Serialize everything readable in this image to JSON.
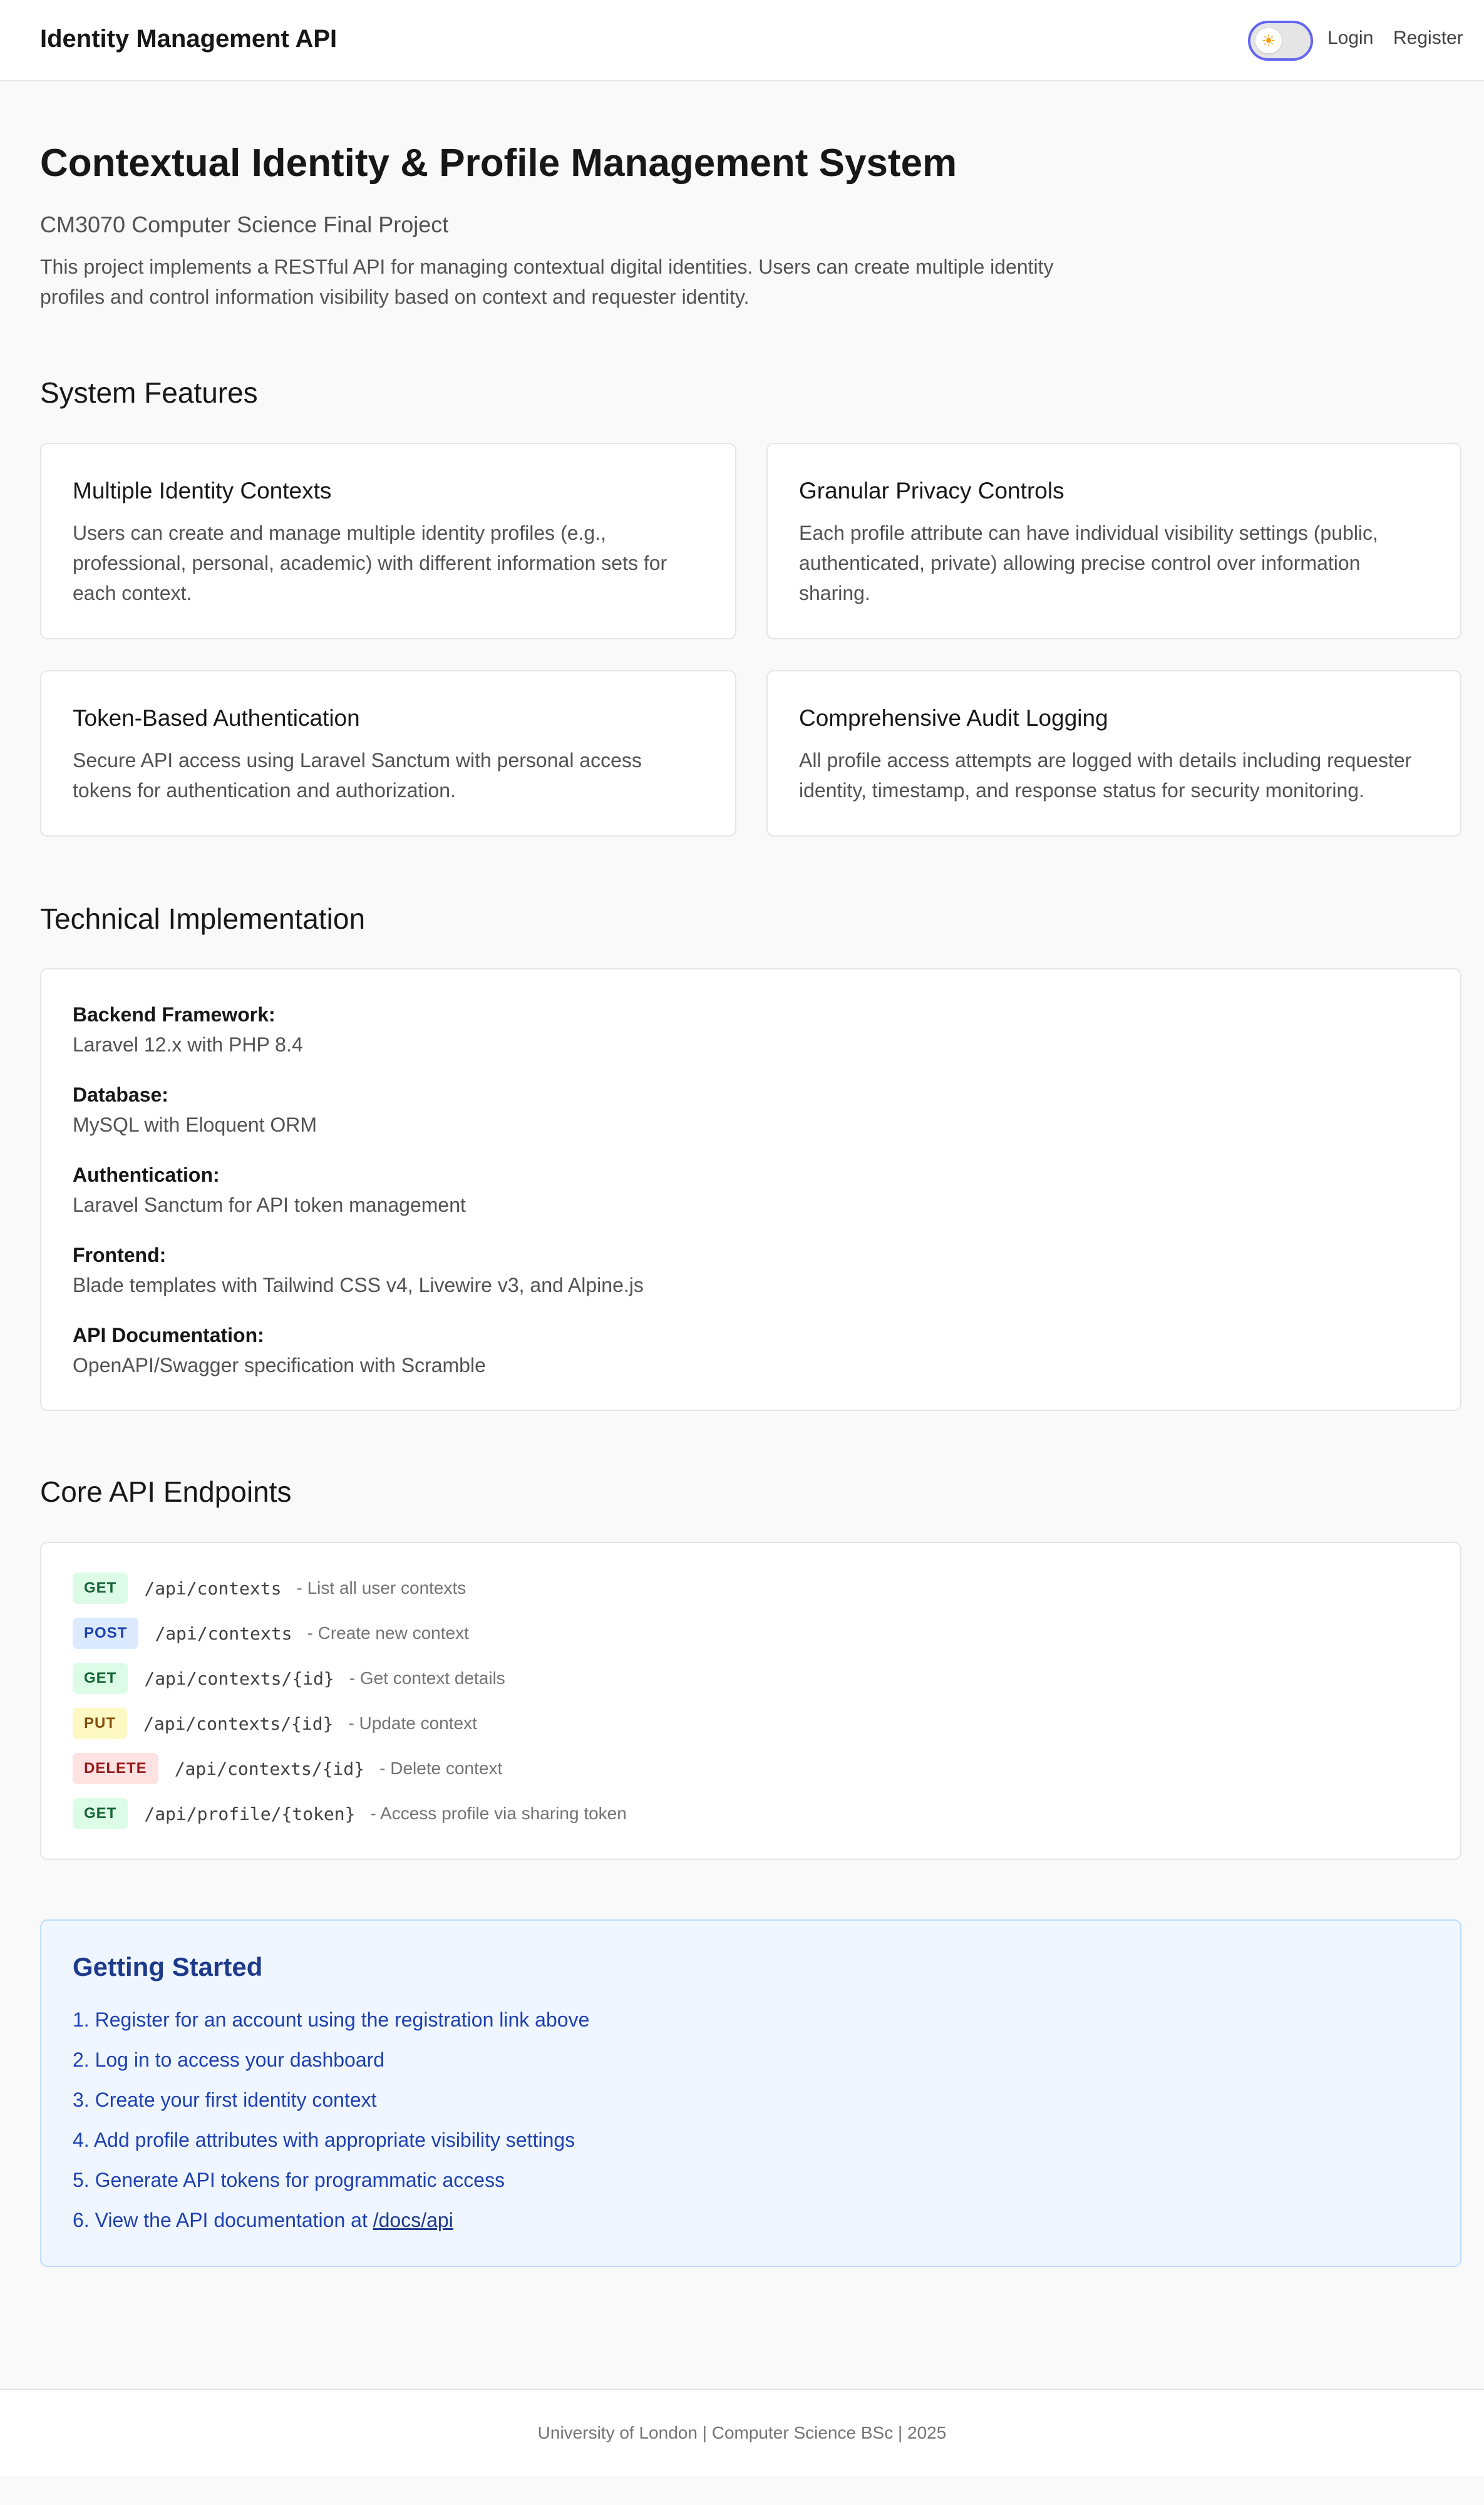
{
  "header": {
    "brand": "Identity Management API",
    "theme_icon": "sun-icon",
    "login_label": "Login",
    "register_label": "Register"
  },
  "hero": {
    "title": "Contextual Identity & Profile Management System",
    "subtitle": "CM3070 Computer Science Final Project",
    "description": "This project implements a RESTful API for managing contextual digital identities. Users can create multiple identity profiles and control information visibility based on context and requester identity."
  },
  "features": {
    "heading": "System Features",
    "items": [
      {
        "title": "Multiple Identity Contexts",
        "text": "Users can create and manage multiple identity profiles (e.g., professional, personal, academic) with different information sets for each context."
      },
      {
        "title": "Granular Privacy Controls",
        "text": "Each profile attribute can have individual visibility settings (public, authenticated, private) allowing precise control over information sharing."
      },
      {
        "title": "Token-Based Authentication",
        "text": "Secure API access using Laravel Sanctum with personal access tokens for authentication and authorization."
      },
      {
        "title": "Comprehensive Audit Logging",
        "text": "All profile access attempts are logged with details including requester identity, timestamp, and response status for security monitoring."
      }
    ]
  },
  "tech": {
    "heading": "Technical Implementation",
    "items": [
      {
        "label": "Backend Framework:",
        "value": "Laravel 12.x with PHP 8.4"
      },
      {
        "label": "Database:",
        "value": "MySQL with Eloquent ORM"
      },
      {
        "label": "Authentication:",
        "value": "Laravel Sanctum for API token management"
      },
      {
        "label": "Frontend:",
        "value": "Blade templates with Tailwind CSS v4, Livewire v3, and Alpine.js"
      },
      {
        "label": "API Documentation:",
        "value": "OpenAPI/Swagger specification with Scramble"
      }
    ]
  },
  "endpoints": {
    "heading": "Core API Endpoints",
    "items": [
      {
        "method": "GET",
        "path": "/api/contexts",
        "desc": "- List all user contexts"
      },
      {
        "method": "POST",
        "path": "/api/contexts",
        "desc": "- Create new context"
      },
      {
        "method": "GET",
        "path": "/api/contexts/{id}",
        "desc": "- Get context details"
      },
      {
        "method": "PUT",
        "path": "/api/contexts/{id}",
        "desc": "- Update context"
      },
      {
        "method": "DELETE",
        "path": "/api/contexts/{id}",
        "desc": "- Delete context"
      },
      {
        "method": "GET",
        "path": "/api/profile/{token}",
        "desc": "- Access profile via sharing token"
      }
    ]
  },
  "getting_started": {
    "title": "Getting Started",
    "steps": [
      "1. Register for an account using the registration link above",
      "2. Log in to access your dashboard",
      "3. Create your first identity context",
      "4. Add profile attributes with appropriate visibility settings",
      "5. Generate API tokens for programmatic access"
    ],
    "step6_prefix": "6. View the API documentation at ",
    "step6_link": "/docs/api"
  },
  "footer": {
    "text": "University of London | Computer Science BSc | 2025"
  }
}
